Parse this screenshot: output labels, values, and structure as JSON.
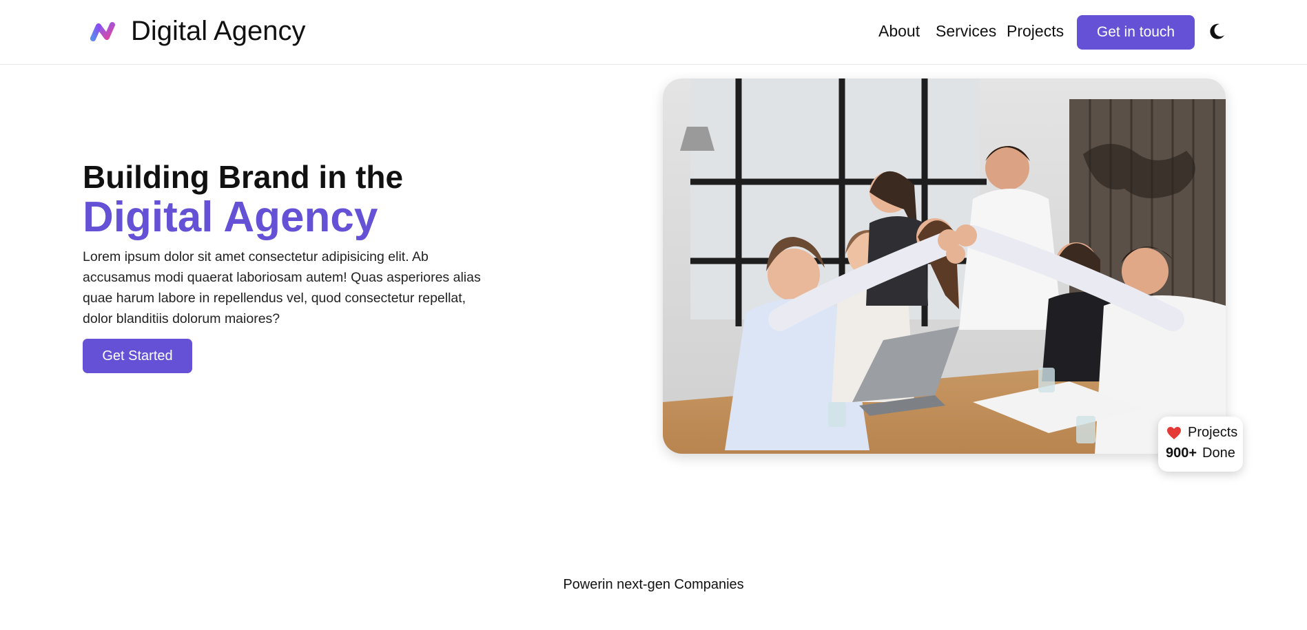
{
  "header": {
    "brand": "Digital Agency",
    "logo_icon": "agency-logo-icon",
    "nav": [
      {
        "label": "About"
      },
      {
        "label": "Services"
      },
      {
        "label": "Projects"
      }
    ],
    "cta_label": "Get in touch",
    "theme_icon": "moon-icon"
  },
  "hero": {
    "line1": "Building Brand in the",
    "line2": "Digital Agency",
    "description": "Lorem ipsum dolor sit amet consectetur adipisicing elit. Ab accusamus modi quaerat laboriosam autem! Quas asperiores alias quae harum labore in repellendus vel, quod consectetur repellat, dolor blanditiis dolorum maiores?",
    "button_label": "Get Started",
    "image_icon": "team-high-five-photo"
  },
  "badge": {
    "icon": "heart-icon",
    "label": "Projects",
    "number": "900+",
    "suffix": "Done"
  },
  "companies": {
    "heading": "Powerin next-gen Companies"
  },
  "colors": {
    "accent": "#6451d6",
    "text": "#111111",
    "heart": "#e53935"
  }
}
